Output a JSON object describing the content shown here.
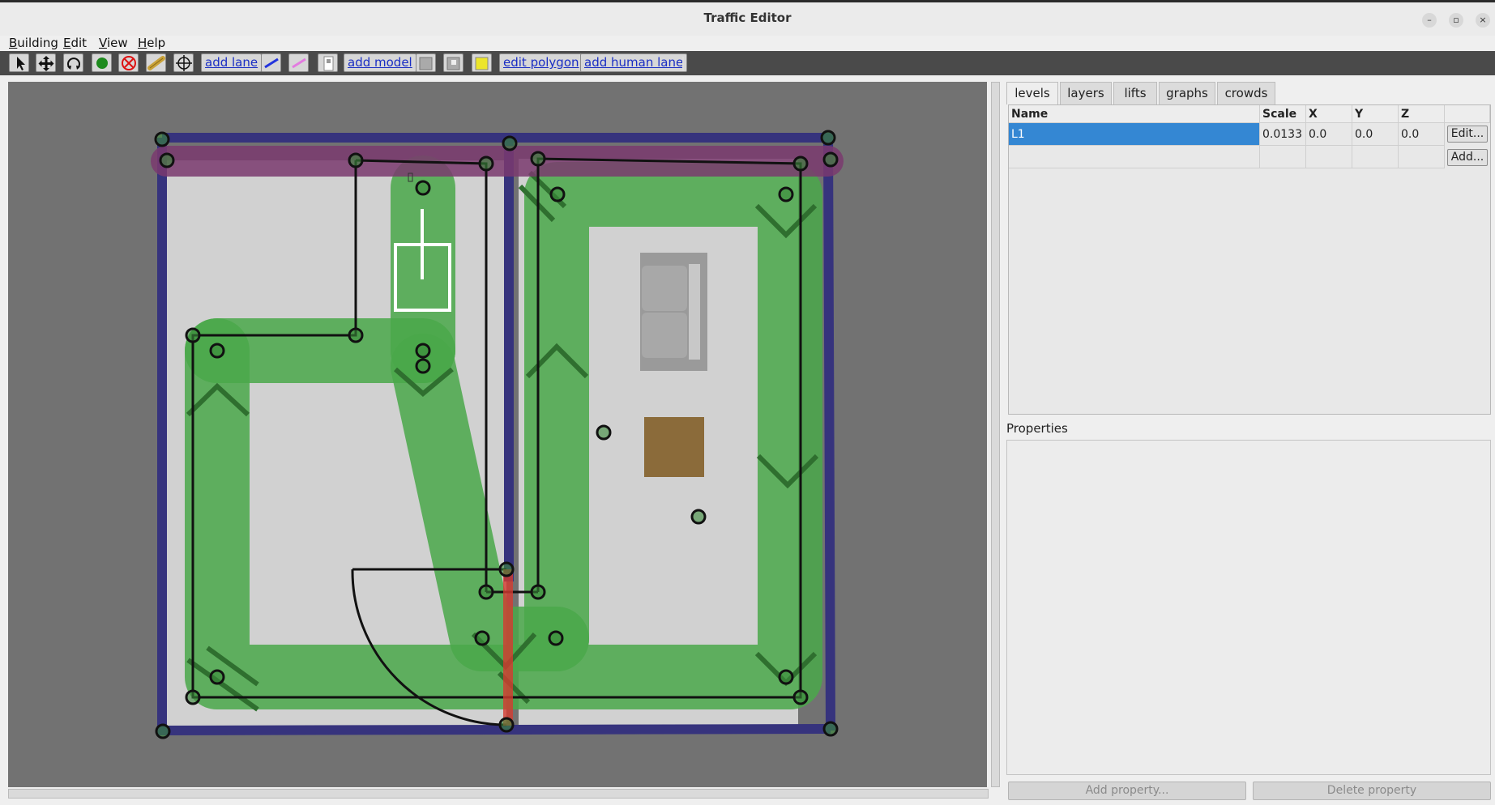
{
  "window": {
    "title": "Traffic Editor"
  },
  "menu": [
    {
      "label": "Building",
      "mnemonic": "B",
      "rest": "uilding"
    },
    {
      "label": "Edit",
      "mnemonic": "E",
      "rest": "dit"
    },
    {
      "label": "View",
      "mnemonic": "V",
      "rest": "iew"
    },
    {
      "label": "Help",
      "mnemonic": "H",
      "rest": "elp"
    }
  ],
  "toolbar": {
    "add_lane": "add lane",
    "add_model": "add model",
    "edit_polygon": "edit polygon",
    "add_human_lane": "add human lane",
    "icons": [
      "select-arrow-icon",
      "move-icon",
      "rotate-icon",
      "add-vertex-icon",
      "delete-icon",
      "add-wall-icon",
      "add-measurement-icon",
      "add-door-icon",
      "add-floor-icon",
      "add-hole-icon",
      "add-zone-icon"
    ]
  },
  "panel": {
    "tabs": [
      "levels",
      "layers",
      "lifts",
      "graphs",
      "crowds"
    ],
    "active_tab": "levels",
    "levels_table": {
      "headers": [
        "Name",
        "Scale",
        "X",
        "Y",
        "Z"
      ],
      "rows": [
        {
          "name": "L1",
          "scale": "0.0133",
          "x": "0.0",
          "y": "0.0",
          "z": "0.0",
          "button": "Edit..."
        }
      ],
      "add_button": "Add..."
    },
    "properties_label": "Properties",
    "add_property": "Add property...",
    "delete_property": "Delete property"
  },
  "colors": {
    "wall": "#36337d",
    "lane": "#4aa84a",
    "floor": "#d0d0d0",
    "canvas_bg": "#727272",
    "selection": "#3487d3",
    "boundary": "#7a3a6e"
  }
}
